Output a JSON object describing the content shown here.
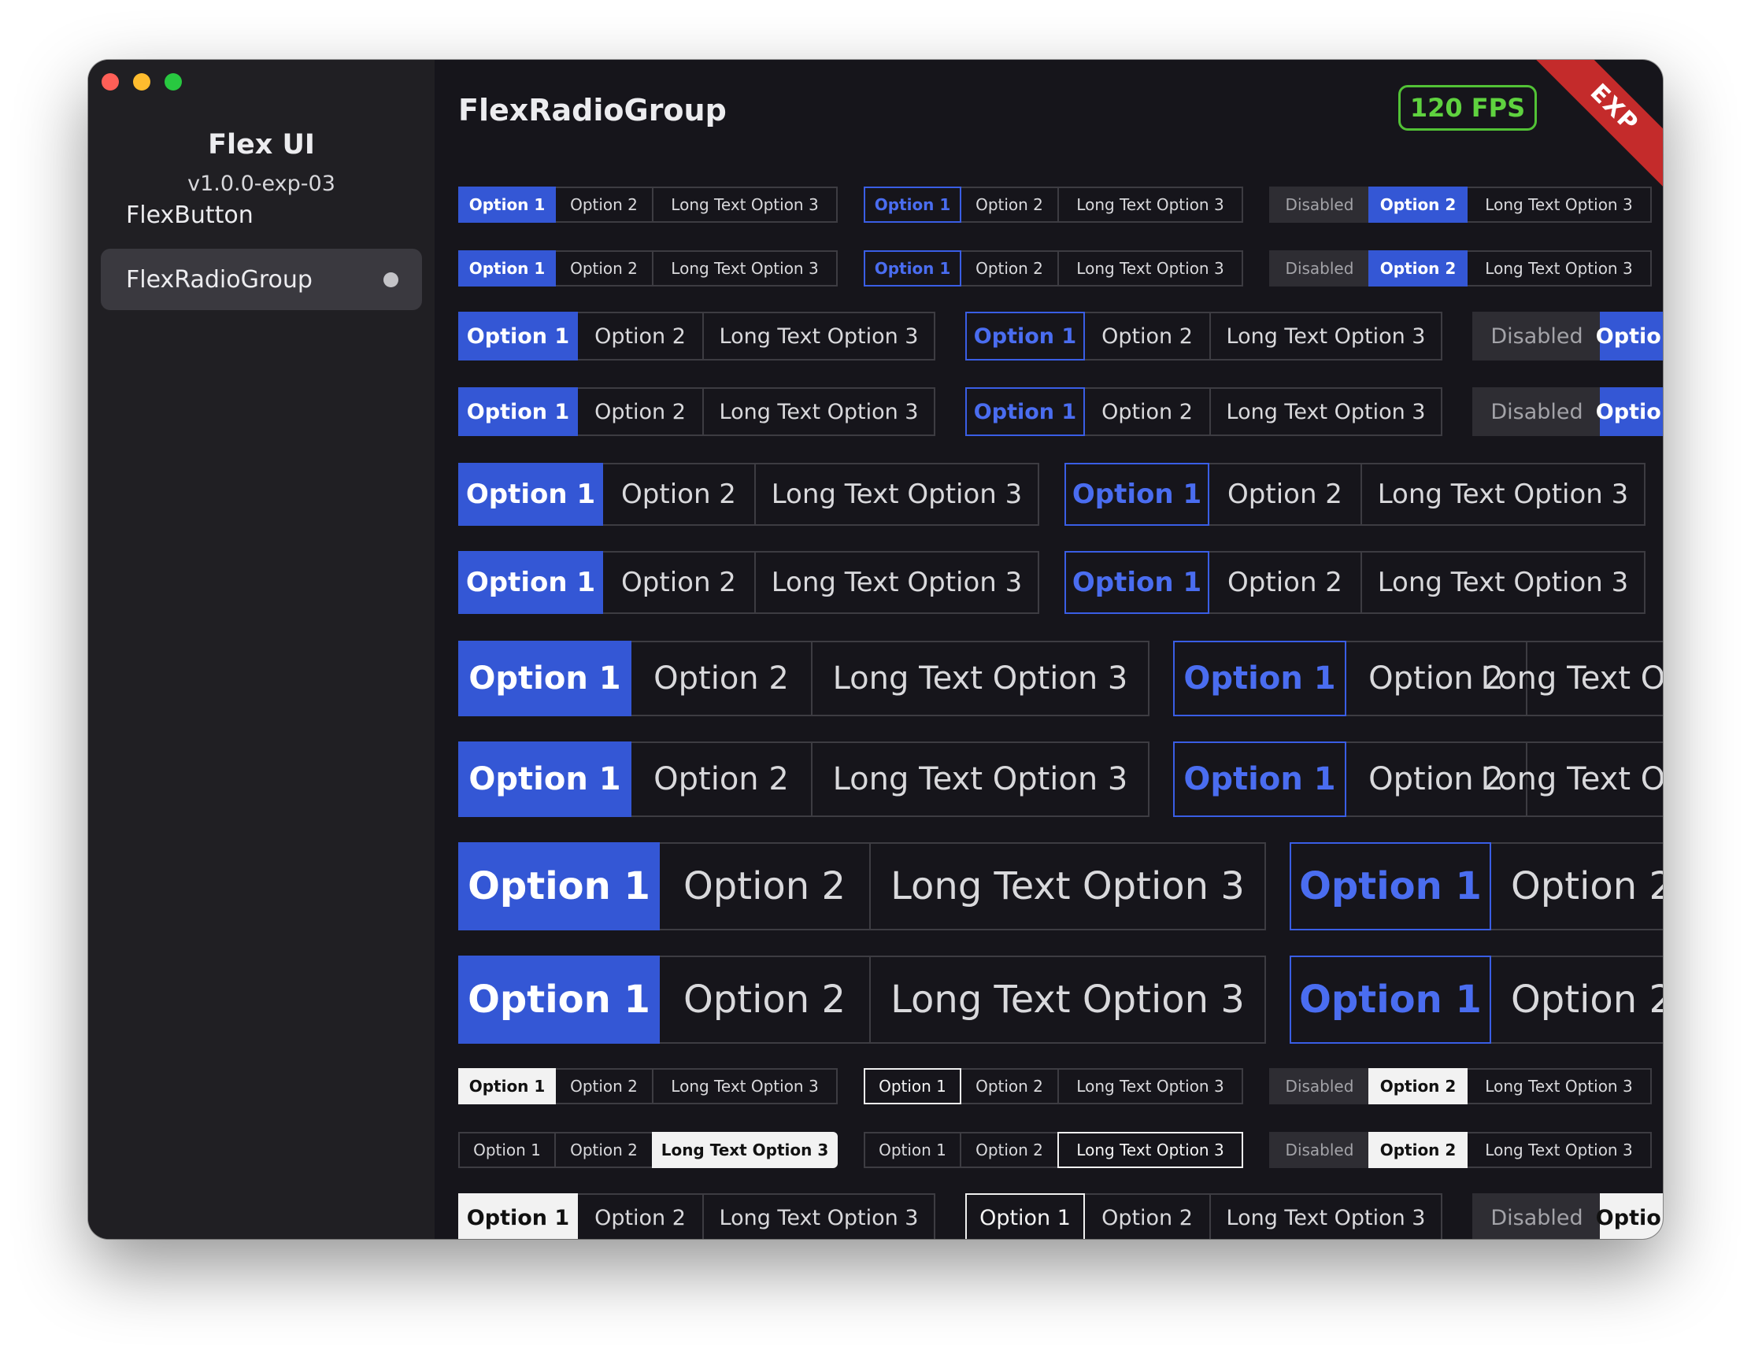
{
  "app": {
    "name": "Flex UI",
    "version": "v1.0.0-exp-03"
  },
  "sidebar": {
    "items": [
      {
        "label": "FlexButton"
      },
      {
        "label": "FlexRadioGroup"
      }
    ]
  },
  "header": {
    "title": "FlexRadioGroup",
    "fps": "120 FPS",
    "ribbon": "EXP"
  },
  "labels": {
    "option1": "Option 1",
    "option2": "Option 2",
    "option3": "Long Text Option 3",
    "disabled": "Disabled"
  },
  "colors": {
    "window_bg": "#16151b",
    "sidebar_bg": "#201f23",
    "selected_accent": "#3457d5",
    "outline_accent": "#3a5ee5",
    "fps_green": "#5fd23f",
    "ribbon_red": "#c42b2b",
    "light_selected": "#f2f2f2"
  },
  "groups_note": "",
  "rows": [
    {
      "variant": "blue",
      "groups": [
        [
          "Option 1",
          "Option 2",
          "Long Text Option 3"
        ],
        [
          "Option 1",
          "Option 2",
          "Long Text Option 3"
        ],
        [
          "Disabled",
          "Option 2",
          "Long Text Option 3"
        ]
      ]
    }
  ]
}
